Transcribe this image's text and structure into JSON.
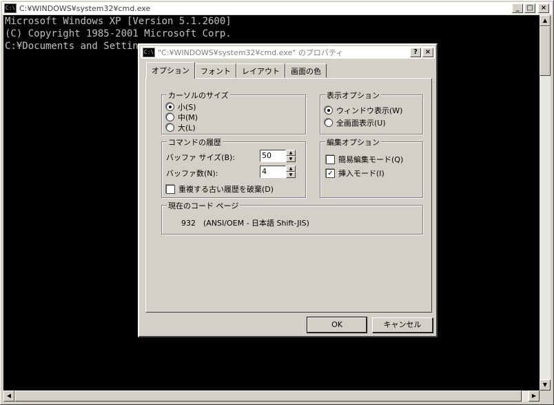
{
  "cmd": {
    "title": "C:¥WINDOWS¥system32¥cmd.exe",
    "icon_text": "C:\\",
    "console_lines": [
      "Microsoft Windows XP [Version 5.1.2600]",
      "(C) Copyright 1985-2001 Microsoft Corp.",
      "",
      "C:¥Documents and Settings"
    ]
  },
  "window_buttons": {
    "minimize": "_",
    "maximize": "□",
    "close": "×"
  },
  "dialog": {
    "title": "\"C:¥WINDOWS¥system32¥cmd.exe\" のプロパティ",
    "help": "?",
    "close": "×",
    "tabs": [
      "オプション",
      "フォント",
      "レイアウト",
      "画面の色"
    ],
    "cursor_size": {
      "label": "カーソルのサイズ",
      "options": [
        "小(S)",
        "中(M)",
        "大(L)"
      ],
      "selected": 0
    },
    "display_options": {
      "label": "表示オプション",
      "options": [
        "ウィンドウ表示(W)",
        "全画面表示(U)"
      ],
      "selected": 0
    },
    "command_history": {
      "label": "コマンドの履歴",
      "buffer_size_label": "バッファ サイズ(B):",
      "buffer_size_value": "50",
      "buffer_count_label": "バッファ数(N):",
      "buffer_count_value": "4",
      "discard_label": "重複する古い履歴を破棄(D)",
      "discard_checked": false
    },
    "edit_options": {
      "label": "編集オプション",
      "quick_edit_label": "簡易編集モード(Q)",
      "quick_edit_checked": false,
      "insert_mode_label": "挿入モード(I)",
      "insert_mode_checked": true
    },
    "code_page": {
      "label": "現在のコード ページ",
      "value": "932　(ANSI/OEM - 日本語 Shift-JIS)"
    },
    "ok_label": "OK",
    "cancel_label": "キャンセル"
  }
}
